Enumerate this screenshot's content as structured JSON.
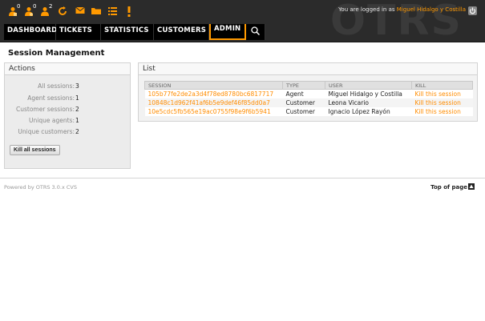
{
  "header": {
    "logo_text": "OTRS",
    "toolbar_counts": {
      "locked": "0",
      "watched": "0",
      "responsible": "2"
    },
    "login_prefix": "You are logged in as",
    "login_user": "Miguel Hidalgo y Costilla"
  },
  "nav": {
    "dashboard": "DASHBOARD",
    "tickets": "TICKETS",
    "statistics": "STATISTICS",
    "customers": "CUSTOMERS",
    "admin": "ADMIN"
  },
  "page_title": "Session Management",
  "actions": {
    "title": "Actions",
    "stats": [
      {
        "label": "All sessions:",
        "value": "3"
      },
      {
        "label": "Agent sessions:",
        "value": "1"
      },
      {
        "label": "Customer sessions:",
        "value": "2"
      },
      {
        "label": "Unique agents:",
        "value": "1"
      },
      {
        "label": "Unique customers:",
        "value": "2"
      }
    ],
    "kill_all_label": "Kill all sessions"
  },
  "list": {
    "title": "List",
    "columns": [
      "SESSION",
      "TYPE",
      "USER",
      "KILL"
    ],
    "rows": [
      {
        "session": "105b77fe2de2a3d4f78ed8780bc6817717",
        "type": "Agent",
        "user": "Miguel Hidalgo y Costilla",
        "kill": "Kill this session"
      },
      {
        "session": "10848c1d962f41af6b5e9def46f85dd0a7",
        "type": "Customer",
        "user": "Leona Vicario",
        "kill": "Kill this session"
      },
      {
        "session": "10e5cdc5fb565e19ac0755f98e9f6b5941",
        "type": "Customer",
        "user": "Ignacio López Rayón",
        "kill": "Kill this session"
      }
    ]
  },
  "footer": {
    "powered": "Powered by OTRS 3.0.x CVS",
    "top_of_page": "Top of page"
  },
  "colors": {
    "accent": "#ff9900",
    "header_bg": "#2b2b2b"
  }
}
